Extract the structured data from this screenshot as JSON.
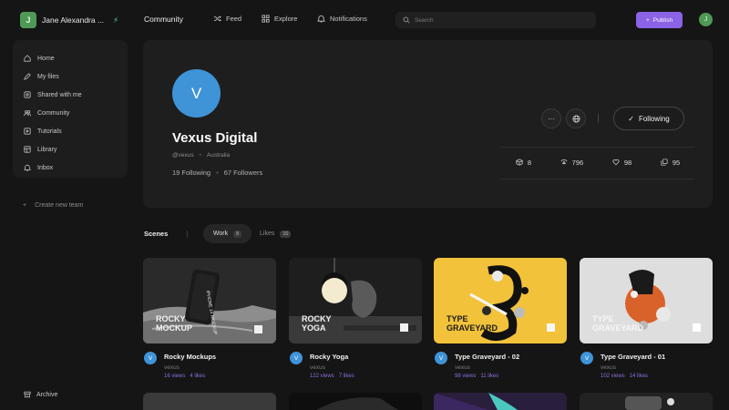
{
  "workspace": {
    "avatar_letter": "J",
    "name": "Jane Alexandra ..."
  },
  "header": {
    "title": "Community",
    "nav": [
      {
        "label": "Feed",
        "icon": "shuffle-icon"
      },
      {
        "label": "Explore",
        "icon": "grid-icon"
      },
      {
        "label": "Notifications",
        "icon": "bell-icon"
      }
    ],
    "search_placeholder": "Search",
    "publish_label": "Publish",
    "user_avatar_letter": "J"
  },
  "sidebar": {
    "items": [
      {
        "label": "Home",
        "icon": "home-icon"
      },
      {
        "label": "My files",
        "icon": "pencil-icon"
      },
      {
        "label": "Shared with me",
        "icon": "shared-icon"
      },
      {
        "label": "Community",
        "icon": "users-icon"
      },
      {
        "label": "Tutorials",
        "icon": "play-icon"
      },
      {
        "label": "Library",
        "icon": "library-icon"
      },
      {
        "label": "Inbox",
        "icon": "bell-icon"
      }
    ],
    "create_team": "Create new team",
    "archive": "Archive"
  },
  "profile": {
    "avatar_letter": "V",
    "name": "Vexus Digital",
    "handle": "@vexus",
    "location": "Australia",
    "following": "19 Following",
    "followers": "67 Followers",
    "follow_button": "Following",
    "stats": [
      {
        "icon": "cube-icon",
        "value": "8"
      },
      {
        "icon": "eye-icon",
        "value": "796"
      },
      {
        "icon": "heart-icon",
        "value": "98"
      },
      {
        "icon": "copy-icon",
        "value": "95"
      }
    ],
    "colors": {
      "avatar": "#3f93d7"
    }
  },
  "scenes": {
    "title": "Scenes",
    "tabs": [
      {
        "label": "Work",
        "count": "8"
      },
      {
        "label": "Likes",
        "count": "10"
      }
    ]
  },
  "cards": [
    {
      "title": "Rocky Mockups",
      "author": "vexus",
      "views": "16 views",
      "likes": "4 likes",
      "avatar": "V",
      "thumb_text": [
        "ROCKY",
        "MOCKUP"
      ],
      "phone_text": "IPHONE 14 MOCKUP"
    },
    {
      "title": "Rocky Yoga",
      "author": "vexus",
      "views": "122 views",
      "likes": "7 likes",
      "avatar": "V",
      "thumb_text": [
        "ROCKY",
        "YOGA"
      ]
    },
    {
      "title": "Type Graveyard - 02",
      "author": "vexus",
      "views": "98 views",
      "likes": "11 likes",
      "avatar": "V",
      "thumb_text": [
        "TYPE",
        "GRAVEYARD"
      ]
    },
    {
      "title": "Type Graveyard - 01",
      "author": "vexus",
      "views": "102 views",
      "likes": "14 likes",
      "avatar": "V",
      "thumb_text": [
        "TYPE",
        "GRAVEYARD"
      ]
    }
  ],
  "theme": {
    "accent": "#8a63e6",
    "green": "#4e9a55",
    "bolt": "#3ddc97",
    "yellow": "#f2c23a"
  }
}
